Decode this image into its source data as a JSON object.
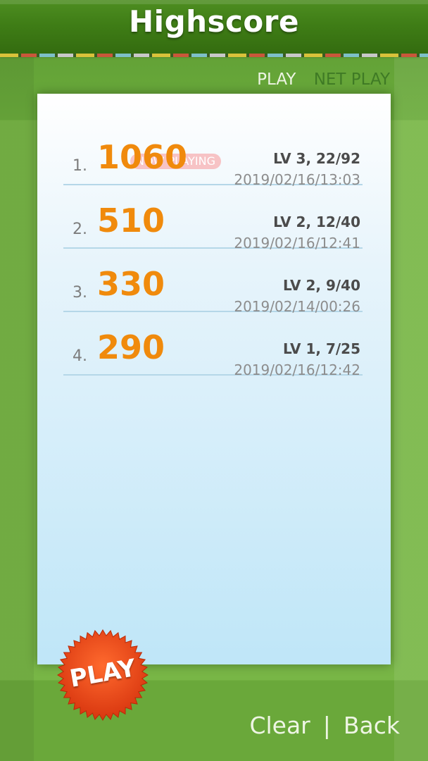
{
  "header": {
    "title": "Highscore"
  },
  "tabs": [
    {
      "label": "PLAY",
      "active": true
    },
    {
      "label": "NET PLAY",
      "active": false
    }
  ],
  "now_playing_label": "NOW PLAYING",
  "scores": [
    {
      "rank": "1.",
      "score": "1060",
      "level": "LV 3, 22/92",
      "date": "2019/02/16/13:03"
    },
    {
      "rank": "2.",
      "score": "510",
      "level": "LV 2, 12/40",
      "date": "2019/02/16/12:41"
    },
    {
      "rank": "3.",
      "score": "330",
      "level": "LV 2, 9/40",
      "date": "2019/02/14/00:26"
    },
    {
      "rank": "4.",
      "score": "290",
      "level": "LV 1, 7/25",
      "date": "2019/02/16/12:42"
    }
  ],
  "play_button": {
    "label": "PLAY"
  },
  "bottom": {
    "clear_label": "Clear",
    "separator": "|",
    "back_label": "Back"
  },
  "colors": {
    "background_green": "#78b646",
    "titlebar_green": "#3f7d16",
    "score_orange": "#f08a0c",
    "play_button_red": "#e8431a",
    "now_playing_badge": "#f7c3c5"
  }
}
